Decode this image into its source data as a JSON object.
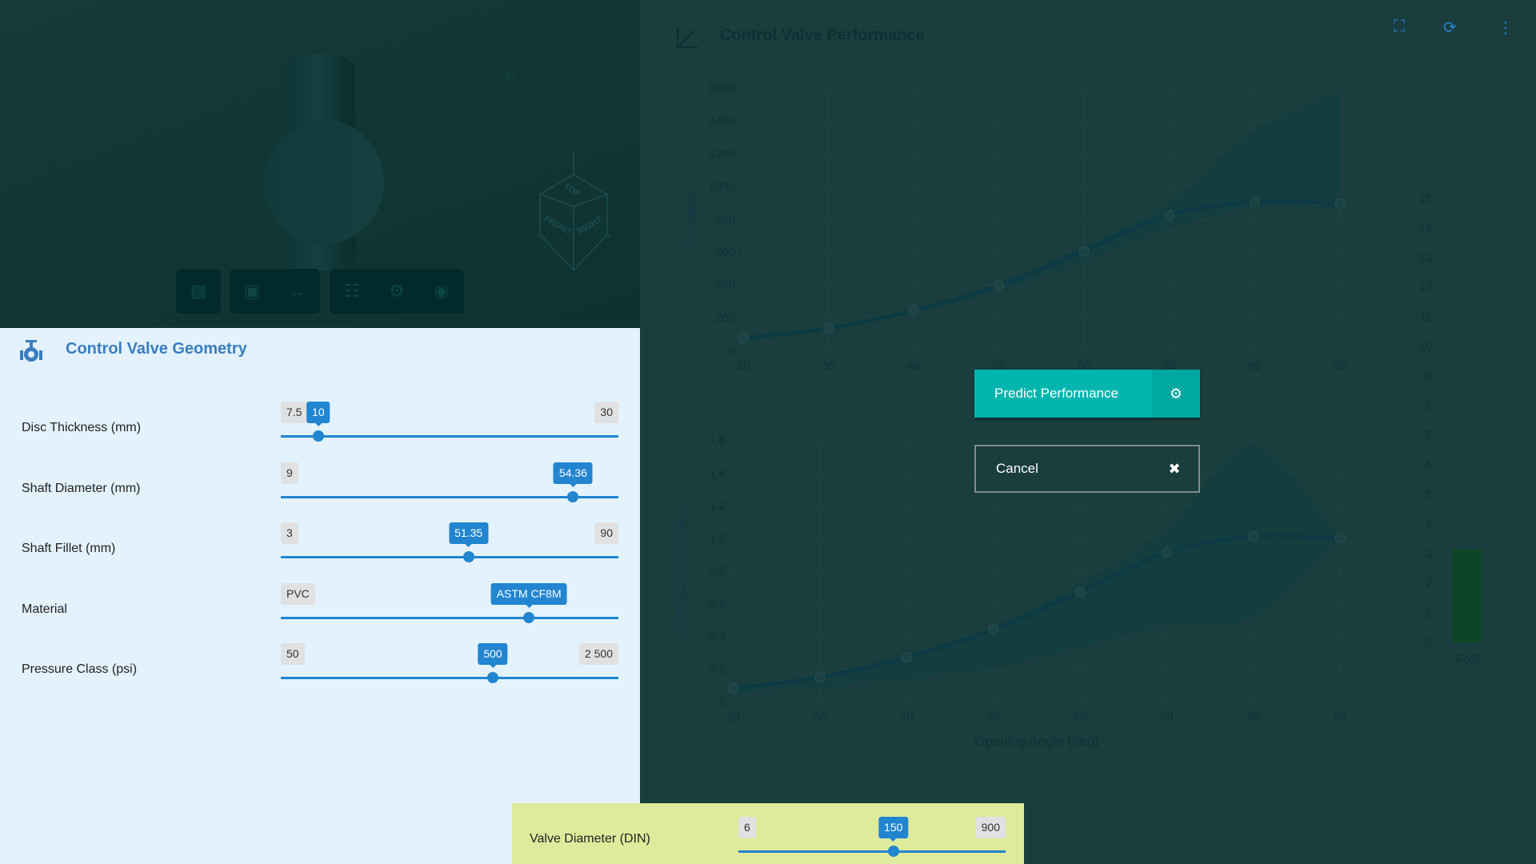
{
  "viewer": {
    "toolbar": [
      {
        "icon": "video-camera-icon"
      },
      {
        "icon": "cube-section-icon"
      },
      {
        "icon": "ruler-measure-icon"
      },
      {
        "icon": "hierarchy-icon"
      },
      {
        "icon": "gear-icon"
      },
      {
        "icon": "camera-icon"
      }
    ],
    "home_icon": "home-icon",
    "cube_faces": [
      "TOP",
      "FRONT",
      "RIGHT"
    ]
  },
  "geometry": {
    "title": "Control Valve Geometry",
    "icon": "valve-icon",
    "accent": "#2185d0",
    "sliders": [
      {
        "label": "Disc Thickness (mm)",
        "min": "7.5",
        "max": "30",
        "value": "10",
        "fraction": 0.111
      },
      {
        "label": "Shaft Diameter (mm)",
        "min": "9",
        "max": "",
        "value": "54.36",
        "fraction": 0.866
      },
      {
        "label": "Shaft Fillet (mm)",
        "min": "3",
        "max": "90",
        "value": "51.35",
        "fraction": 0.556
      },
      {
        "label": "Material",
        "min": "PVC",
        "max": "",
        "value": "ASTM CF8M",
        "fraction": 0.735
      },
      {
        "label": "Pressure Class (psi)",
        "min": "50",
        "max": "2 500",
        "value": "500",
        "fraction": 0.628
      }
    ]
  },
  "valve_diameter": {
    "label": "Valve Diameter (DIN)",
    "min": "6",
    "max": "900",
    "value": "150",
    "fraction": 0.58
  },
  "performance": {
    "title": "Control Valve Performance",
    "icons": [
      "fullscreen-icon",
      "refresh-icon",
      "more-vertical-icon"
    ]
  },
  "dialog": {
    "predict_label": "Predict Performance",
    "cancel_label": "Cancel",
    "predict_color": "#00b5ad"
  },
  "chart_data": [
    {
      "type": "line",
      "ylabel": "Cv Value",
      "x": [
        20,
        30,
        40,
        50,
        60,
        70,
        80,
        90
      ],
      "xlim": [
        20,
        90
      ],
      "ylim": [
        0,
        1600
      ],
      "yticks": [
        0,
        200,
        400,
        600,
        800,
        1000,
        1200,
        1400,
        1600
      ],
      "values": [
        75,
        135,
        245,
        395,
        605,
        825,
        905,
        895
      ],
      "band_upper": [
        80,
        140,
        250,
        410,
        640,
        900,
        1340,
        1580
      ],
      "band_lower": [
        60,
        120,
        230,
        360,
        540,
        750,
        870,
        860
      ],
      "grid": true
    },
    {
      "type": "line",
      "ylabel": "Normalized Cv Value",
      "xlabel": "Opening Angle (deg)",
      "x": [
        20,
        30,
        40,
        50,
        60,
        70,
        80,
        90
      ],
      "xlim": [
        20,
        90
      ],
      "ylim": [
        0,
        1.6
      ],
      "yticks": [
        "0",
        "0.2",
        "0.4",
        "0.6",
        "0.8",
        "1.0",
        "1.2",
        "1.4",
        "1.6"
      ],
      "values": [
        0.08,
        0.15,
        0.27,
        0.44,
        0.67,
        0.91,
        1.01,
        1.0
      ],
      "band_upper": [
        0.09,
        0.16,
        0.29,
        0.46,
        0.72,
        1.05,
        1.56,
        1.0
      ],
      "band_lower": [
        0.05,
        0.09,
        0.14,
        0.21,
        0.33,
        0.47,
        0.52,
        1.0
      ],
      "grid": true
    },
    {
      "type": "bar",
      "categories": [
        "FoS"
      ],
      "values": [
        3.15
      ],
      "ylim": [
        0,
        15
      ],
      "yticks": [
        0,
        1,
        2,
        3,
        4,
        5,
        6,
        7,
        8,
        9,
        10,
        11,
        12,
        13,
        14,
        15
      ],
      "color": "#0f4527"
    }
  ]
}
